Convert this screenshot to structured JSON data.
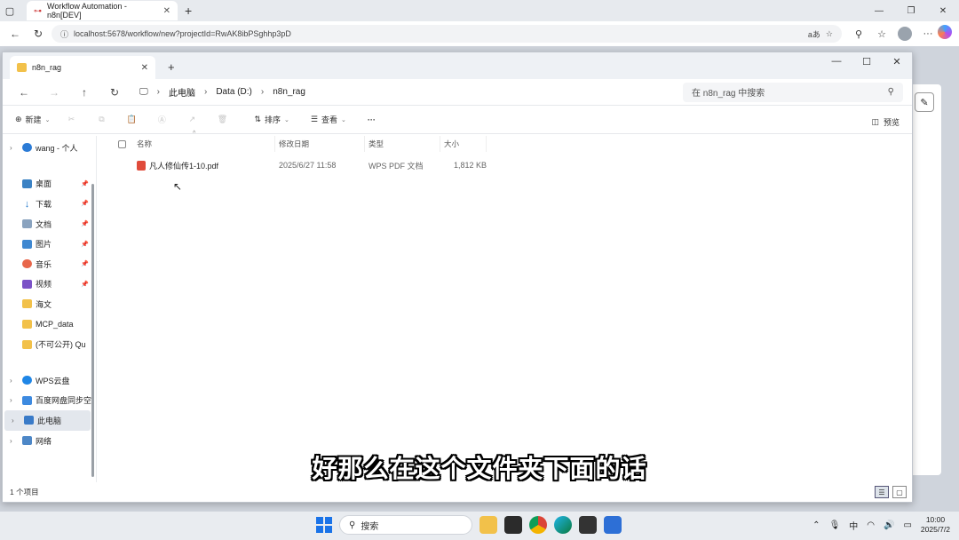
{
  "browser": {
    "tab_title": "Workflow Automation - n8n[DEV]",
    "url": "localhost:5678/workflow/new?projectId=RwAK8ibPSghhp3pD"
  },
  "explorer": {
    "tab_title": "n8n_rag",
    "breadcrumbs": [
      "此电脑",
      "Data (D:)",
      "n8n_rag"
    ],
    "search_placeholder": "在 n8n_rag 中搜索",
    "toolbar": {
      "new_label": "新建",
      "sort_label": "排序",
      "view_label": "查看",
      "more_label": "···",
      "preview_label": "预览"
    },
    "sidebar": {
      "top": [
        {
          "label": "wang - 个人",
          "icon": "cloud-icon"
        }
      ],
      "quick": [
        {
          "label": "桌面",
          "icon": "desktop-icon",
          "pinned": true
        },
        {
          "label": "下载",
          "icon": "download-icon",
          "pinned": true
        },
        {
          "label": "文档",
          "icon": "document-icon",
          "pinned": true
        },
        {
          "label": "图片",
          "icon": "picture-icon",
          "pinned": true
        },
        {
          "label": "音乐",
          "icon": "music-icon",
          "pinned": true
        },
        {
          "label": "视频",
          "icon": "video-icon",
          "pinned": true
        },
        {
          "label": "海文",
          "icon": "folder-icon",
          "pinned": false
        },
        {
          "label": "MCP_data",
          "icon": "folder-icon",
          "pinned": false
        },
        {
          "label": "(不可公开) Qu",
          "icon": "folder-icon",
          "pinned": false
        }
      ],
      "bottom": [
        {
          "label": "WPS云盘",
          "icon": "wps-cloud-icon"
        },
        {
          "label": "百度网盘同步空",
          "icon": "baidu-sync-icon"
        },
        {
          "label": "此电脑",
          "icon": "pc-icon",
          "selected": true
        },
        {
          "label": "网络",
          "icon": "network-icon"
        }
      ]
    },
    "columns": {
      "name": "名称",
      "modified": "修改日期",
      "type": "类型",
      "size": "大小"
    },
    "files": [
      {
        "name": "凡人修仙传1-10.pdf",
        "modified": "2025/6/27 11:58",
        "type": "WPS PDF 文档",
        "size": "1,812 KB"
      }
    ],
    "status": "1 个项目"
  },
  "subtitle": "好那么在这个文件夹下面的话",
  "taskbar": {
    "search_label": "搜索",
    "ime": "中",
    "time": "10:00",
    "date": "2025/7/2"
  }
}
